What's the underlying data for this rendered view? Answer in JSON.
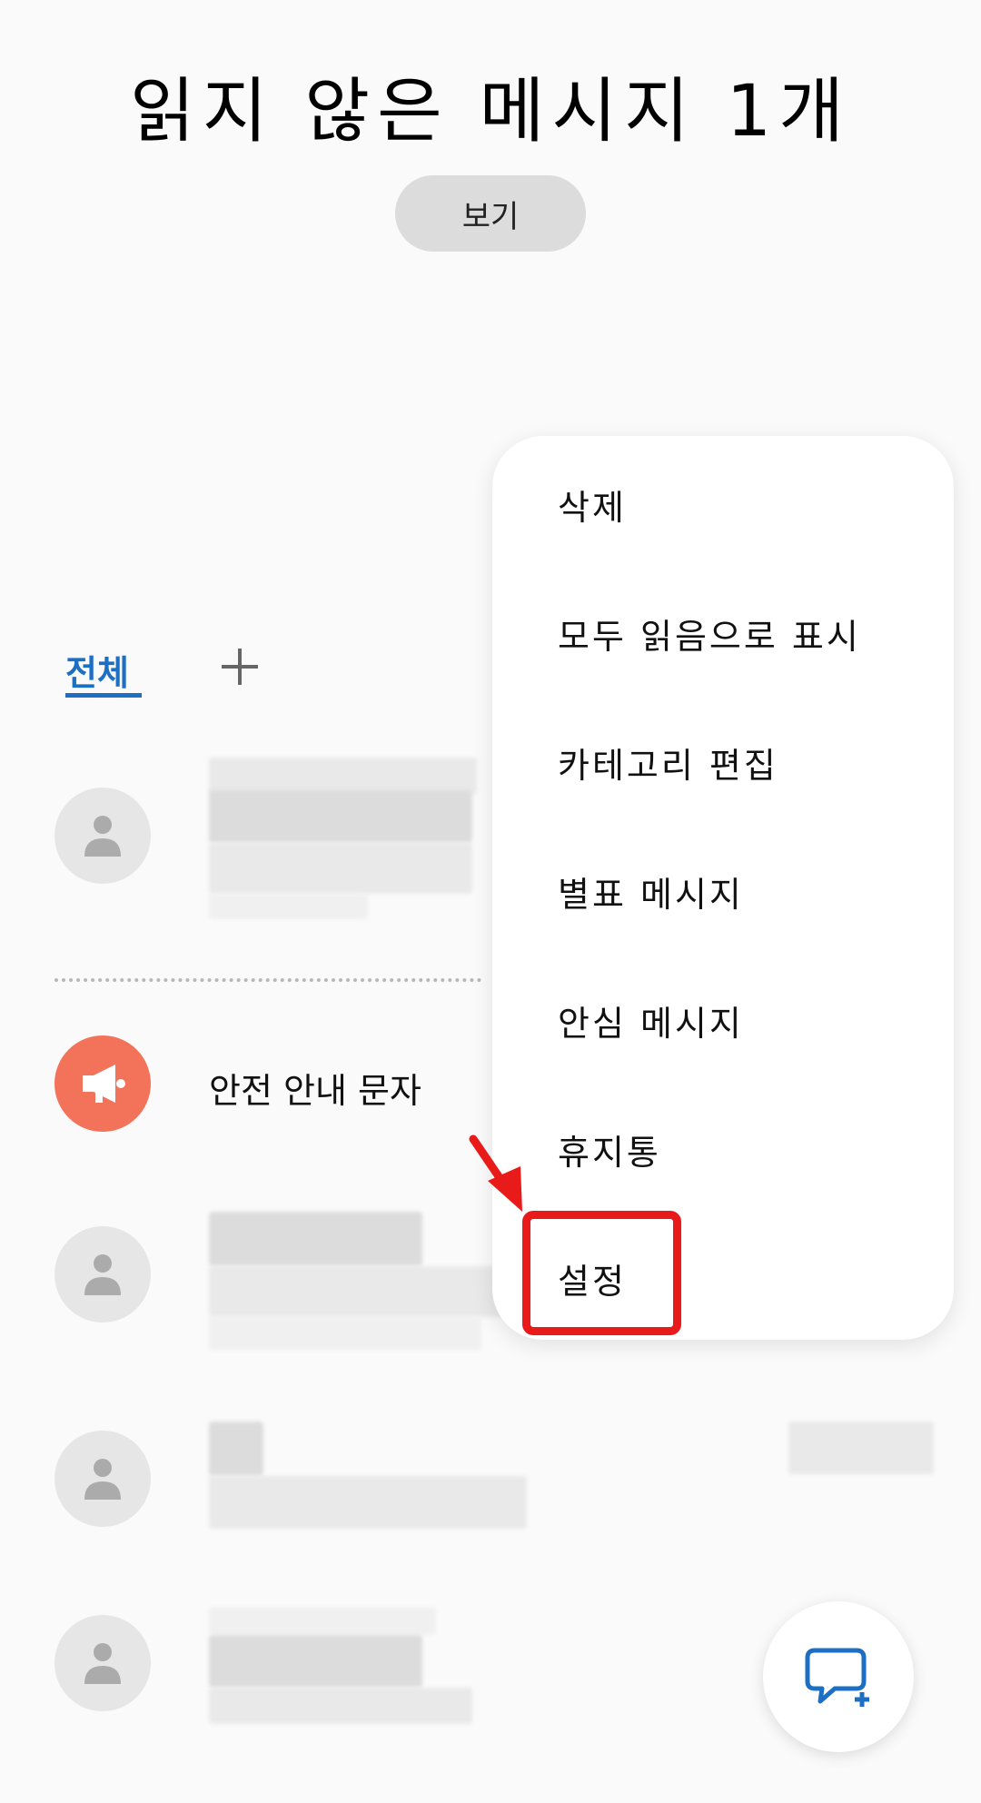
{
  "header": {
    "title": "읽지 않은 메시지 1개",
    "view_button": "보기"
  },
  "tabs": {
    "all_label": "전체",
    "add_icon": "plus-icon"
  },
  "conversations": [
    {
      "name": "",
      "avatar": "person-icon"
    },
    {
      "name": "안전 안내 문자",
      "avatar": "megaphone-icon"
    },
    {
      "name": "",
      "avatar": "person-icon"
    },
    {
      "name": "",
      "avatar": "person-icon"
    },
    {
      "name": "",
      "avatar": "person-icon"
    }
  ],
  "menu": {
    "items": [
      {
        "label": "삭제"
      },
      {
        "label": "모두 읽음으로 표시"
      },
      {
        "label": "카테고리 편집"
      },
      {
        "label": "별표 메시지"
      },
      {
        "label": "안심 메시지"
      },
      {
        "label": "휴지통"
      },
      {
        "label": "설정"
      }
    ]
  },
  "fab": {
    "icon": "new-message-icon"
  },
  "colors": {
    "accent": "#1d6fc4",
    "highlight": "#e81a1a",
    "safety_avatar": "#f2735a"
  }
}
